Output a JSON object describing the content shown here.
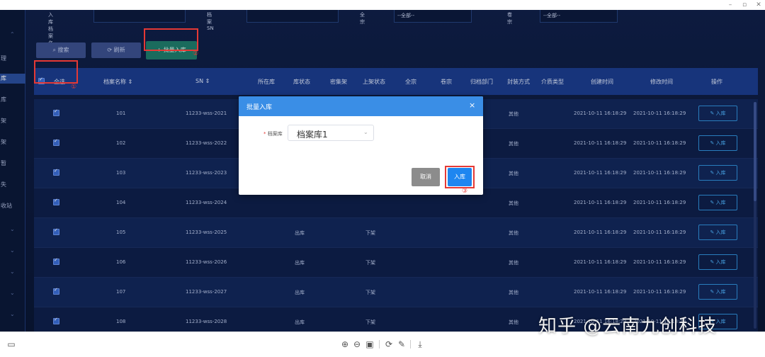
{
  "window": {
    "minimize": "–",
    "restore": "▫",
    "close": "✕"
  },
  "filters": {
    "archive_name_label": "入库档案名称",
    "archive_sn_label": "档案SN",
    "select1_label": "全宗",
    "select1_value": "--全部--",
    "select2_label": "卷宗",
    "select2_value": "--全部--"
  },
  "sidebar": {
    "items": [
      "理",
      "库",
      "库",
      "架",
      "架",
      "暂",
      "失",
      "收站"
    ]
  },
  "toolbar": {
    "search_label": "搜索",
    "refresh_label": "刷新",
    "batch_label": "+ 批量入库"
  },
  "annotations": {
    "one": "①",
    "two": "②",
    "three": "③"
  },
  "table": {
    "select_all": "全选",
    "headers": [
      "档案名称 ⇕",
      "SN ⇕",
      "所在库",
      "库状态",
      "密集架",
      "上架状态",
      "全宗",
      "卷宗",
      "归档部门",
      "封装方式",
      "介质类型",
      "创建时间",
      "修改时间",
      "操作"
    ],
    "rows": [
      {
        "name": "101",
        "sn": "11233-wss-2021",
        "location": "",
        "shelf_status": "",
        "seal": "其他",
        "created": "2021-10-11 16:18:29",
        "modified": "2021-10-11 16:18:29",
        "action": "✎ 入库"
      },
      {
        "name": "102",
        "sn": "11233-wss-2022",
        "location": "",
        "shelf_status": "",
        "seal": "其他",
        "created": "2021-10-11 16:18:29",
        "modified": "2021-10-11 16:18:29",
        "action": "✎ 入库"
      },
      {
        "name": "103",
        "sn": "11233-wss-2023",
        "location": "",
        "shelf_status": "",
        "seal": "其他",
        "created": "2021-10-11 16:18:29",
        "modified": "2021-10-11 16:18:29",
        "action": "✎ 入库"
      },
      {
        "name": "104",
        "sn": "11233-wss-2024",
        "location": "",
        "shelf_status": "",
        "seal": "其他",
        "created": "2021-10-11 16:18:29",
        "modified": "2021-10-11 16:18:29",
        "action": "✎ 入库"
      },
      {
        "name": "105",
        "sn": "11233-wss-2025",
        "location": "出库",
        "shelf_status": "下架",
        "seal": "其他",
        "created": "2021-10-11 16:18:29",
        "modified": "2021-10-11 16:18:29",
        "action": "✎ 入库"
      },
      {
        "name": "106",
        "sn": "11233-wss-2026",
        "location": "出库",
        "shelf_status": "下架",
        "seal": "其他",
        "created": "2021-10-11 16:18:29",
        "modified": "2021-10-11 16:18:29",
        "action": "✎ 入库"
      },
      {
        "name": "107",
        "sn": "11233-wss-2027",
        "location": "出库",
        "shelf_status": "下架",
        "seal": "其他",
        "created": "2021-10-11 16:18:29",
        "modified": "2021-10-11 16:18:29",
        "action": "✎ 入库"
      },
      {
        "name": "108",
        "sn": "11233-wss-2028",
        "location": "出库",
        "shelf_status": "下架",
        "seal": "其他",
        "created": "2021-10-11 16:18:29",
        "modified": "2021-10-11 16:18:29",
        "action": "✎ 入库"
      }
    ]
  },
  "modal": {
    "title": "批量入库",
    "close": "×",
    "field_required": "*",
    "field_label": "档案库",
    "field_value": "档案库1",
    "cancel_label": "取消",
    "confirm_label": "入库"
  },
  "watermark": "知乎 @云南九创科技",
  "bottom_toolbar": {
    "icons": [
      "panel-icon",
      "zoom-in-icon",
      "zoom-out-icon",
      "fit-icon",
      "rotate-icon",
      "edit-icon",
      "download-icon"
    ]
  },
  "colors": {
    "app_bg": "#0d1a3c",
    "table_header": "#1b3c8c",
    "accent_blue": "#1e86f0",
    "highlight_red": "#e53935",
    "batch_green": "#1e7a6a"
  }
}
